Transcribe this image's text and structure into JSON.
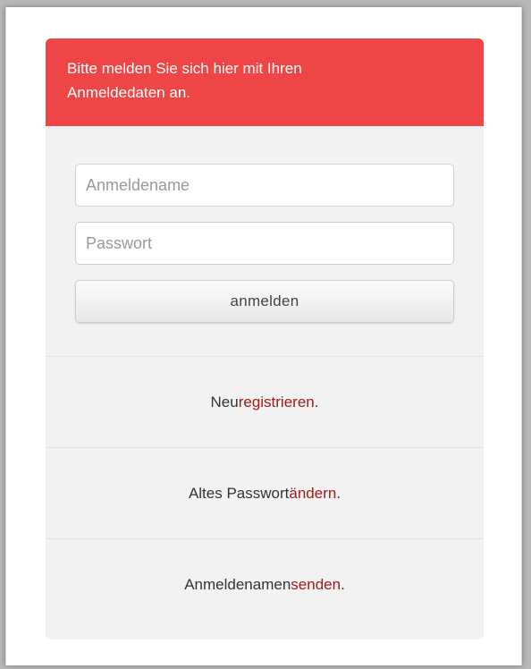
{
  "header": {
    "message_line1": "Bitte melden Sie sich hier mit Ihren",
    "message_line2": "Anmeldedaten an."
  },
  "form": {
    "username_placeholder": "Anmeldename",
    "username_value": "",
    "password_placeholder": "Passwort",
    "password_value": "",
    "submit_label": "anmelden"
  },
  "links": {
    "register": {
      "prefix": "Neu ",
      "link": "registrieren",
      "suffix": "."
    },
    "change_password": {
      "prefix": "Altes Passwort ",
      "link": "ändern",
      "suffix": "."
    },
    "send_username": {
      "prefix": "Anmeldenamen ",
      "link": "senden",
      "suffix": "."
    }
  },
  "colors": {
    "header_bg": "#ee4646",
    "panel_bg": "#f2f2f2",
    "link": "#a11b1b"
  }
}
